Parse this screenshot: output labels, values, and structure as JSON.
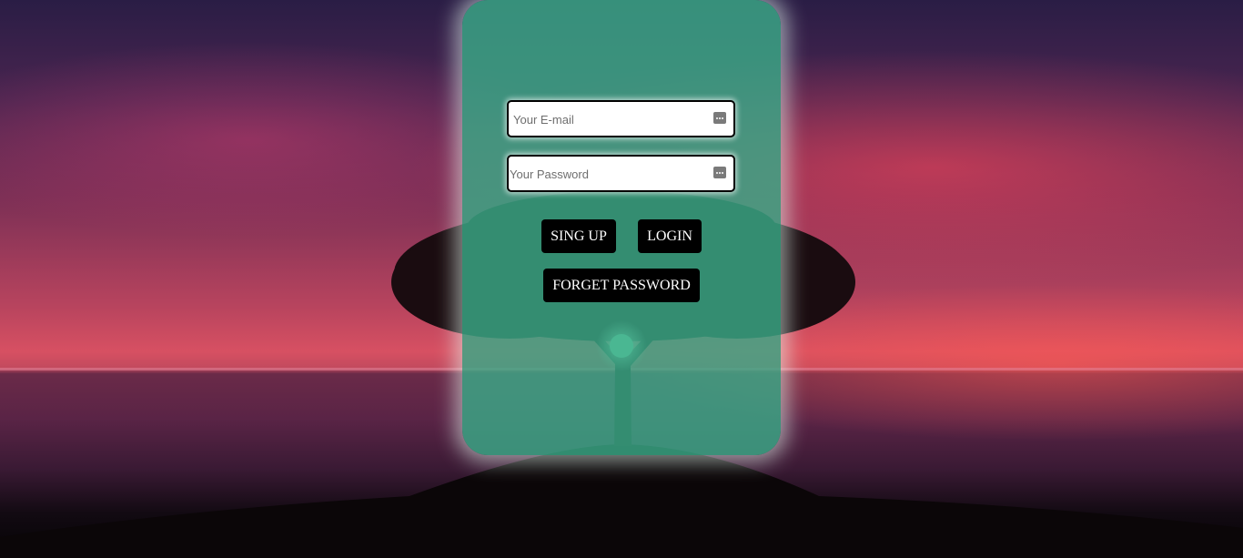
{
  "form": {
    "email_placeholder": "Your E-mail",
    "password_placeholder": "Your Password",
    "signup_label": "SING UP",
    "login_label": "LOGIN",
    "forget_label": "FORGET PASSWORD"
  },
  "icons": {
    "field_icon": "password-manager-key-icon"
  },
  "colors": {
    "card": "#3aaa87",
    "button": "#000000",
    "button_text": "#ffffff"
  }
}
